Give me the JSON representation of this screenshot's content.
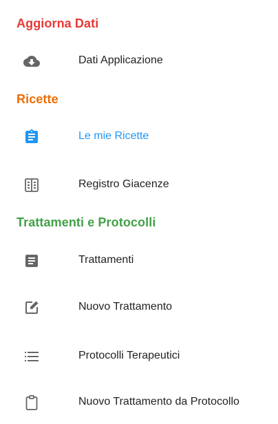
{
  "colors": {
    "aggiorna": "#e53935",
    "ricette": "#ef6c00",
    "trattamenti": "#43a047",
    "active": "#2196f3",
    "icon": "#666666",
    "text": "#222222"
  },
  "sections": {
    "aggiorna": {
      "title": "Aggiorna Dati",
      "items": [
        {
          "label": "Dati Applicazione",
          "icon": "cloud-download-icon"
        }
      ]
    },
    "ricette": {
      "title": "Ricette",
      "items": [
        {
          "label": "Le mie Ricette",
          "icon": "assignment-icon",
          "active": true
        },
        {
          "label": "Registro Giacenze",
          "icon": "ledger-icon"
        }
      ]
    },
    "trattamenti": {
      "title": "Trattamenti e Protocolli",
      "items": [
        {
          "label": "Trattamenti",
          "icon": "document-icon"
        },
        {
          "label": "Nuovo Trattamento",
          "icon": "edit-icon"
        },
        {
          "label": "Protocolli Terapeutici",
          "icon": "list-icon"
        },
        {
          "label": "Nuovo Trattamento da Protocollo",
          "icon": "clipboard-icon"
        }
      ]
    }
  }
}
